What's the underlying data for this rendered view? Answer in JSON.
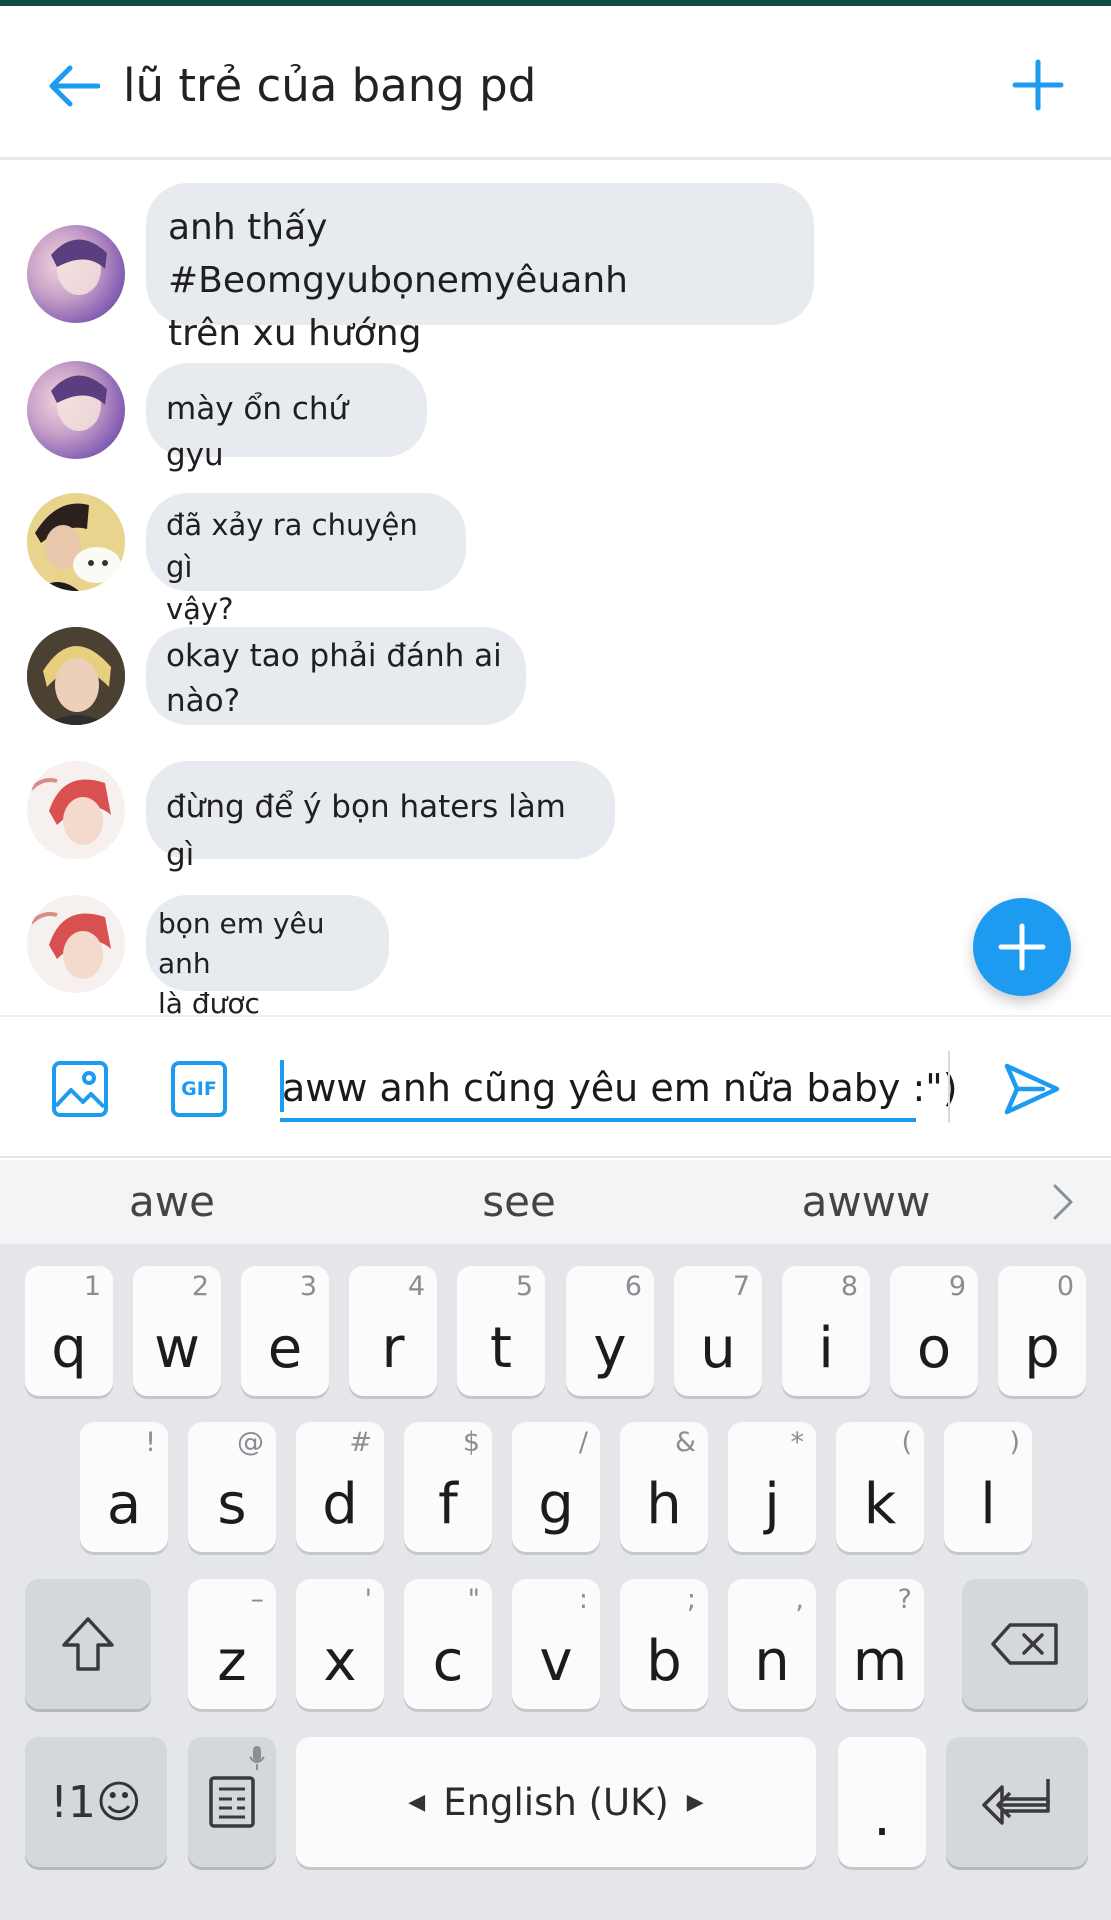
{
  "header": {
    "title": "lũ trẻ của bang pd",
    "back_icon": "arrow-left-icon",
    "add_icon": "plus-icon",
    "accent": "#1d9bf0"
  },
  "messages": [
    {
      "text": "anh thấy #Beomgyubọnemyêuanh\ntrên xu hướng",
      "avatar": "avatar-purple"
    },
    {
      "text": "mày ổn chứ gyu",
      "avatar": "avatar-purple"
    },
    {
      "text": "đã xảy ra chuyện gì\nvậy?",
      "avatar": "avatar-boy-plush"
    },
    {
      "text": "okay tao phải đánh ai\nnào?",
      "avatar": "avatar-blond"
    },
    {
      "text": "đừng để ý bọn haters làm gì",
      "avatar": "avatar-redhair"
    },
    {
      "text": "bọn em yêu anh\nlà được",
      "avatar": "avatar-redhair"
    }
  ],
  "composer": {
    "input_value": "aww anh cũng yêu em nữa baby :\")",
    "image_icon": "image-icon",
    "gif_label": "GIF",
    "send_icon": "send-icon"
  },
  "suggestions": [
    "awe",
    "see",
    "awww"
  ],
  "keyboard": {
    "row1": [
      {
        "key": "q",
        "hint": "1"
      },
      {
        "key": "w",
        "hint": "2"
      },
      {
        "key": "e",
        "hint": "3"
      },
      {
        "key": "r",
        "hint": "4"
      },
      {
        "key": "t",
        "hint": "5"
      },
      {
        "key": "y",
        "hint": "6"
      },
      {
        "key": "u",
        "hint": "7"
      },
      {
        "key": "i",
        "hint": "8"
      },
      {
        "key": "o",
        "hint": "9"
      },
      {
        "key": "p",
        "hint": "0"
      }
    ],
    "row2": [
      {
        "key": "a",
        "hint": "!"
      },
      {
        "key": "s",
        "hint": "@"
      },
      {
        "key": "d",
        "hint": "#"
      },
      {
        "key": "f",
        "hint": "$"
      },
      {
        "key": "g",
        "hint": "/"
      },
      {
        "key": "h",
        "hint": "&"
      },
      {
        "key": "j",
        "hint": "*"
      },
      {
        "key": "k",
        "hint": "("
      },
      {
        "key": "l",
        "hint": ")"
      }
    ],
    "row3": [
      {
        "key": "z",
        "hint": "–"
      },
      {
        "key": "x",
        "hint": "'"
      },
      {
        "key": "c",
        "hint": "\""
      },
      {
        "key": "v",
        "hint": ":"
      },
      {
        "key": "b",
        "hint": ";"
      },
      {
        "key": "n",
        "hint": ","
      },
      {
        "key": "m",
        "hint": "?"
      }
    ],
    "symbols_label": "!1☺",
    "space_label": "English (UK)",
    "period_label": "."
  }
}
